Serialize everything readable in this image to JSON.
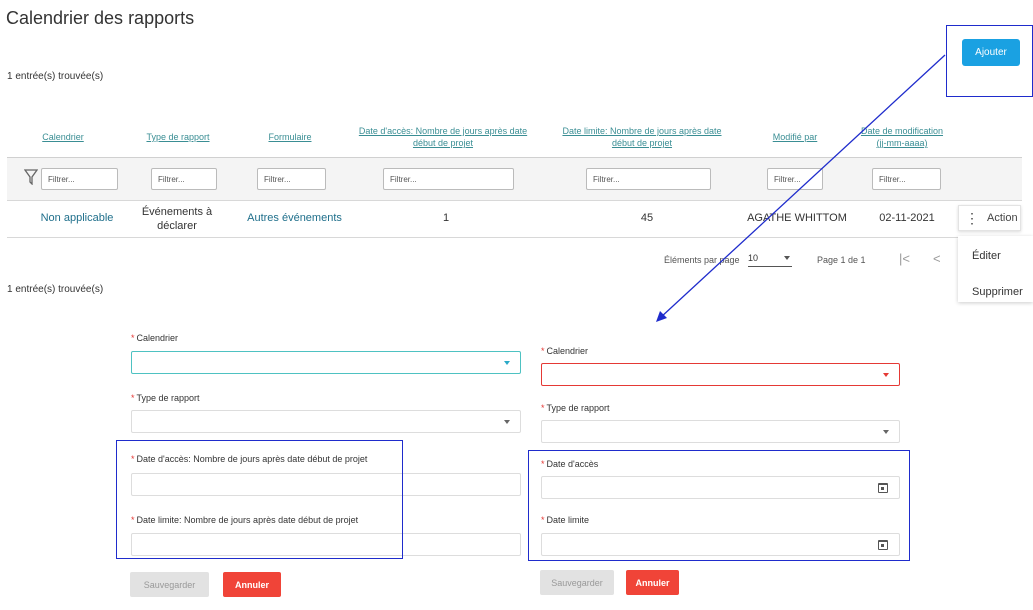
{
  "page": {
    "title": "Calendrier des rapports",
    "count_top": "1 entrée(s) trouvée(s)",
    "count_bottom": "1 entrée(s) trouvée(s)",
    "add_button": "Ajouter"
  },
  "table": {
    "headers": {
      "calendrier": "Calendrier",
      "type": "Type de rapport",
      "formulaire": "Formulaire",
      "acces_l1": "Date d'accès: Nombre de jours après date",
      "acces_l2": "début de projet",
      "limite_l1": "Date limite: Nombre de jours après date",
      "limite_l2": "début de projet",
      "modifie_par": "Modifié par",
      "date_modif_l1": "Date de modification",
      "date_modif_l2": "(jj-mm-aaaa)"
    },
    "filter_placeholder": "Filtrer...",
    "row": {
      "calendrier": "Non applicable",
      "type_l1": "Événements à",
      "type_l2": "déclarer",
      "formulaire": "Autres événements",
      "acces": "1",
      "limite": "45",
      "modifie_par": "AGATHE WHITTOM",
      "date_modif": "02-11-2021"
    },
    "action_label": "Action",
    "menu": {
      "edit": "Éditer",
      "delete": "Supprimer"
    }
  },
  "pagination": {
    "items_per_page_label": "Éléments par page",
    "items_per_page": "10",
    "page_info": "Page 1 de 1"
  },
  "form_left": {
    "calendrier_label": "Calendrier",
    "type_label": "Type de rapport",
    "acces_label": "Date d'accès: Nombre de jours après date début de projet",
    "limite_label": "Date limite: Nombre de jours après date début de projet",
    "save": "Sauvegarder",
    "cancel": "Annuler"
  },
  "form_right": {
    "calendrier_label": "Calendrier",
    "type_label": "Type de rapport",
    "acces_label": "Date d'accès",
    "limite_label": "Date limite",
    "save": "Sauvegarder",
    "cancel": "Annuler"
  },
  "colors": {
    "primary": "#1aa1e2",
    "link": "#3a8e94",
    "danger": "#f04438",
    "callout": "#1f2ccc"
  }
}
